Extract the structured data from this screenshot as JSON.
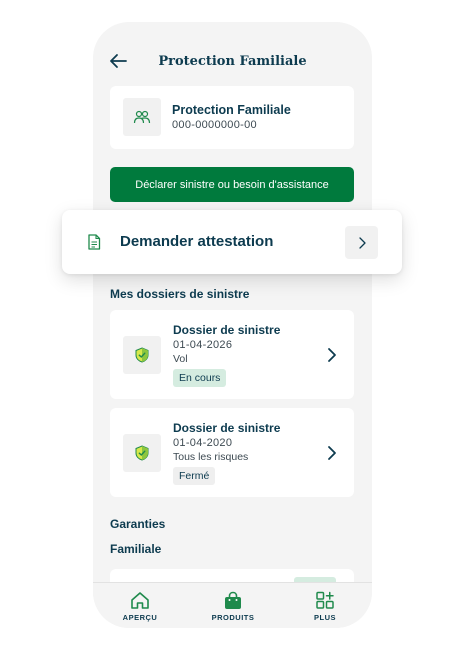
{
  "header": {
    "title": "Protection Familiale",
    "back_icon": "arrow-left-icon"
  },
  "product": {
    "name": "Protection Familiale",
    "number": "000-0000000-00",
    "icon": "family-icon"
  },
  "primary_action": {
    "label": "Déclarer sinistre ou besoin d'assistance"
  },
  "attestation": {
    "label": "Demander attestation",
    "icon": "document-icon",
    "chevron_icon": "chevron-right-icon"
  },
  "claims": {
    "section_title": "Mes dossiers de sinistre",
    "items": [
      {
        "title": "Dossier de sinistre",
        "date": "01-04-2026",
        "type": "Vol",
        "status": "En cours",
        "status_kind": "active"
      },
      {
        "title": "Dossier de sinistre",
        "date": "01-04-2020",
        "type": "Tous les risques",
        "status": "Fermé",
        "status_kind": "closed"
      }
    ]
  },
  "guarantees": {
    "section_title": "Garanties",
    "subsection_title": "Familiale"
  },
  "bottom_nav": {
    "items": [
      {
        "label": "APERÇU",
        "icon": "home-icon"
      },
      {
        "label": "PRODUITS",
        "icon": "shopping-bag-icon"
      },
      {
        "label": "PLUS",
        "icon": "grid-plus-icon"
      }
    ]
  },
  "colors": {
    "primary_green": "#007a3d",
    "text_dark": "#0d3b4f",
    "badge_active_bg": "#d5ece0",
    "background": "#f4f4f4"
  }
}
